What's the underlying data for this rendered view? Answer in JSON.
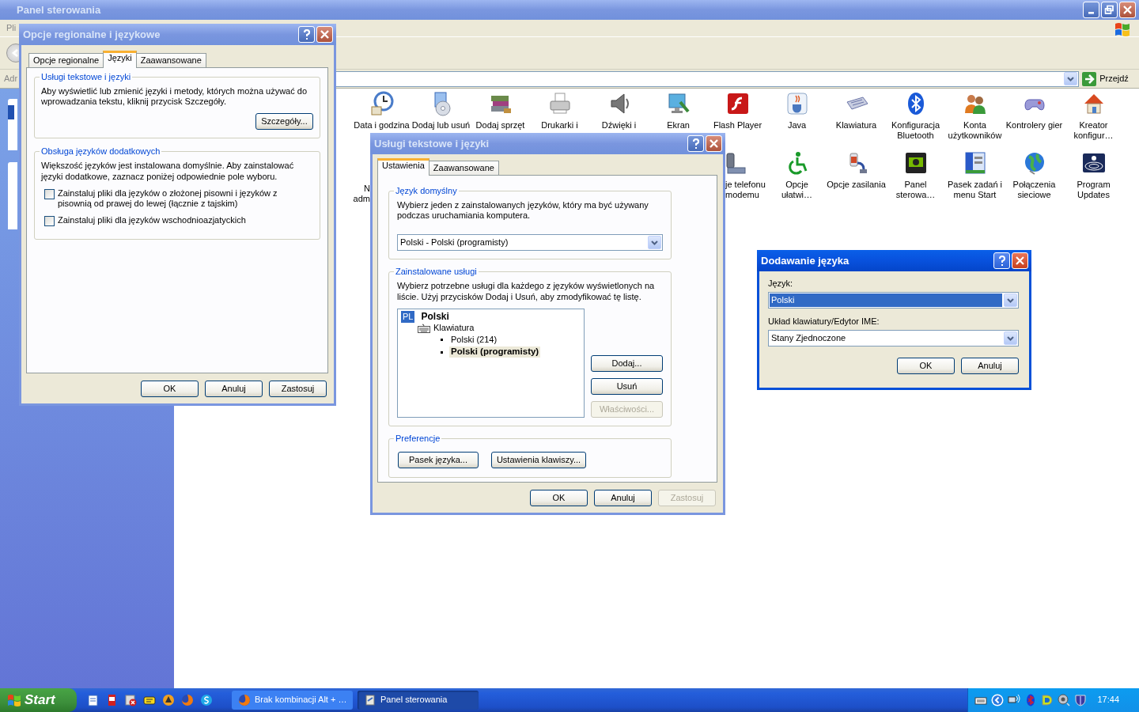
{
  "main_window": {
    "title": "Panel sterowania",
    "active": false,
    "menu_fragment": "Pli",
    "address_label": "Adr",
    "go_button": "Przejdź",
    "icons_row_1": [
      {
        "label": "Data i godzina"
      },
      {
        "label": "Dodaj lub usuń"
      },
      {
        "label": "Dodaj sprzęt"
      },
      {
        "label": "Drukarki i"
      },
      {
        "label": "Dźwięki i"
      },
      {
        "label": "Ekran"
      },
      {
        "label": "Flash Player"
      },
      {
        "label": "Java"
      },
      {
        "label": "Klawiatura"
      },
      {
        "label": "Konfiguracja\nBluetooth"
      },
      {
        "label": "Konta\nużytkowników"
      },
      {
        "label": "Kontrolery gier"
      },
      {
        "label": "Kreator\nkonfigur…"
      }
    ],
    "icons_row_2": [
      {
        "label": "N\nadm",
        "kind": "cut-right"
      },
      {
        "label": "je telefonu\nmodemu",
        "kind": "cut-left"
      },
      {
        "label": "Opcje\nułatwi…",
        "kind": "full"
      },
      {
        "label": "Opcje zasilania",
        "kind": "full"
      },
      {
        "label": "Panel\nsterowa…",
        "kind": "full"
      },
      {
        "label": "Pasek zadań i\nmenu Start",
        "kind": "full"
      },
      {
        "label": "Połączenia\nsieciowe",
        "kind": "full"
      },
      {
        "label": "Program\nUpdates",
        "kind": "full"
      }
    ]
  },
  "regional_dialog": {
    "title": "Opcje regionalne i językowe",
    "active": false,
    "tabs": [
      {
        "label": "Opcje regionalne",
        "selected": false
      },
      {
        "label": "Języki",
        "selected": true
      },
      {
        "label": "Zaawansowane",
        "selected": false
      }
    ],
    "text_services": {
      "legend": "Usługi tekstowe i języki",
      "text": "Aby wyświetlić lub zmienić języki i metody, których można używać do wprowadzania tekstu, kliknij przycisk Szczegóły.",
      "button": "Szczegóły..."
    },
    "supplemental": {
      "legend": "Obsługa języków dodatkowych",
      "text": "Większość języków jest instalowana domyślnie. Aby zainstalować języki dodatkowe, zaznacz poniżej odpowiednie pole wyboru.",
      "checkboxes": [
        {
          "label": "Zainstaluj pliki dla języków o złożonej pisowni i języków z pisownią od prawej do lewej (łącznie z tajskim)",
          "checked": false
        },
        {
          "label": "Zainstaluj pliki dla języków wschodnioazjatyckich",
          "checked": false
        }
      ]
    },
    "buttons": [
      {
        "label": "OK",
        "disabled": false
      },
      {
        "label": "Anuluj",
        "disabled": false
      },
      {
        "label": "Zastosuj",
        "disabled": false
      }
    ]
  },
  "text_services_dialog": {
    "title": "Usługi tekstowe i języki",
    "active": false,
    "tabs": [
      {
        "label": "Ustawienia",
        "selected": true
      },
      {
        "label": "Zaawansowane",
        "selected": false
      }
    ],
    "default_language": {
      "legend": "Język domyślny",
      "text": "Wybierz jeden z zainstalowanych języków, który ma być używany podczas uruchamiania komputera.",
      "value": "Polski - Polski (programisty)"
    },
    "installed": {
      "legend": "Zainstalowane usługi",
      "text": "Wybierz potrzebne usługi dla każdego z języków wyświetlonych na liście. Użyj przycisków Dodaj i Usuń, aby zmodyfikować tę listę.",
      "tree": [
        {
          "code": "PL",
          "label": "Polski",
          "children": [
            {
              "label": "Klawiatura",
              "children": [
                {
                  "label": "Polski (214)",
                  "selected": false
                },
                {
                  "label": "Polski (programisty)",
                  "selected": true
                }
              ]
            }
          ]
        }
      ],
      "buttons": [
        {
          "label": "Dodaj...",
          "disabled": false
        },
        {
          "label": "Usuń",
          "disabled": false
        },
        {
          "label": "Właściwości...",
          "disabled": true
        }
      ]
    },
    "preferences": {
      "legend": "Preferencje",
      "buttons": [
        {
          "label": "Pasek języka...",
          "disabled": false
        },
        {
          "label": "Ustawienia klawiszy...",
          "disabled": false
        }
      ]
    },
    "buttons": [
      {
        "label": "OK",
        "disabled": false
      },
      {
        "label": "Anuluj",
        "disabled": false
      },
      {
        "label": "Zastosuj",
        "disabled": true
      }
    ]
  },
  "add_language_dialog": {
    "title": "Dodawanie języka",
    "active": true,
    "fields": [
      {
        "label": "Język:",
        "value": "Polski",
        "selected": true
      },
      {
        "label": "Układ klawiatury/Edytor IME:",
        "value": "Stany Zjednoczone",
        "selected": false
      }
    ],
    "buttons": [
      {
        "label": "OK",
        "disabled": false
      },
      {
        "label": "Anuluj",
        "disabled": false
      }
    ]
  },
  "taskbar": {
    "start": "Start",
    "tasks": [
      {
        "label": "Brak kombinacji Alt + …",
        "selected": false
      },
      {
        "label": "Panel sterowania",
        "selected": true
      }
    ],
    "clock": "17:44"
  }
}
